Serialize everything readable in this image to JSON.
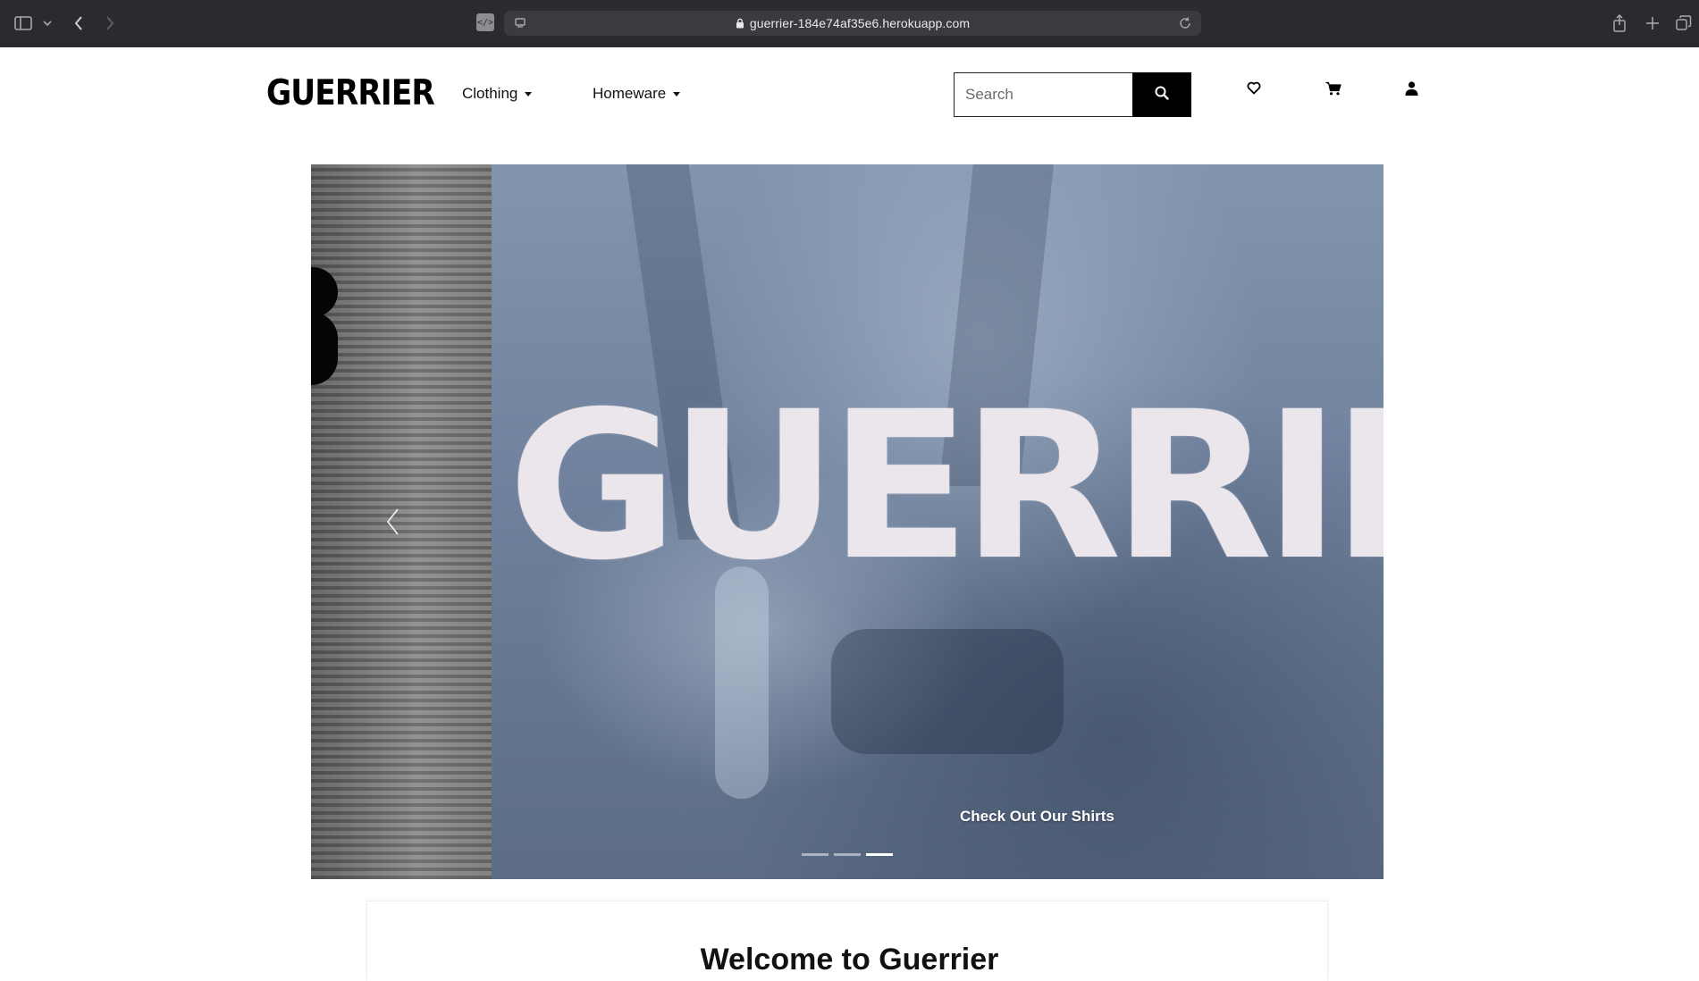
{
  "browser": {
    "url": "guerrier-184e74af35e6.herokuapp.com"
  },
  "header": {
    "logo": "GUERRIER",
    "nav": [
      {
        "label": "Clothing"
      },
      {
        "label": "Homeware"
      }
    ],
    "search": {
      "placeholder": "Search",
      "value": ""
    }
  },
  "carousel": {
    "slide_text": "GUERRIER",
    "caption": "Check Out Our Shirts",
    "indicator_count": 3,
    "active_indicator": 3
  },
  "welcome": {
    "prefix": "Welcome to ",
    "brand": "Guerrier"
  },
  "colors": {
    "brand": "#000000",
    "background": "#ffffff",
    "chrome": "#2b2a2e"
  }
}
